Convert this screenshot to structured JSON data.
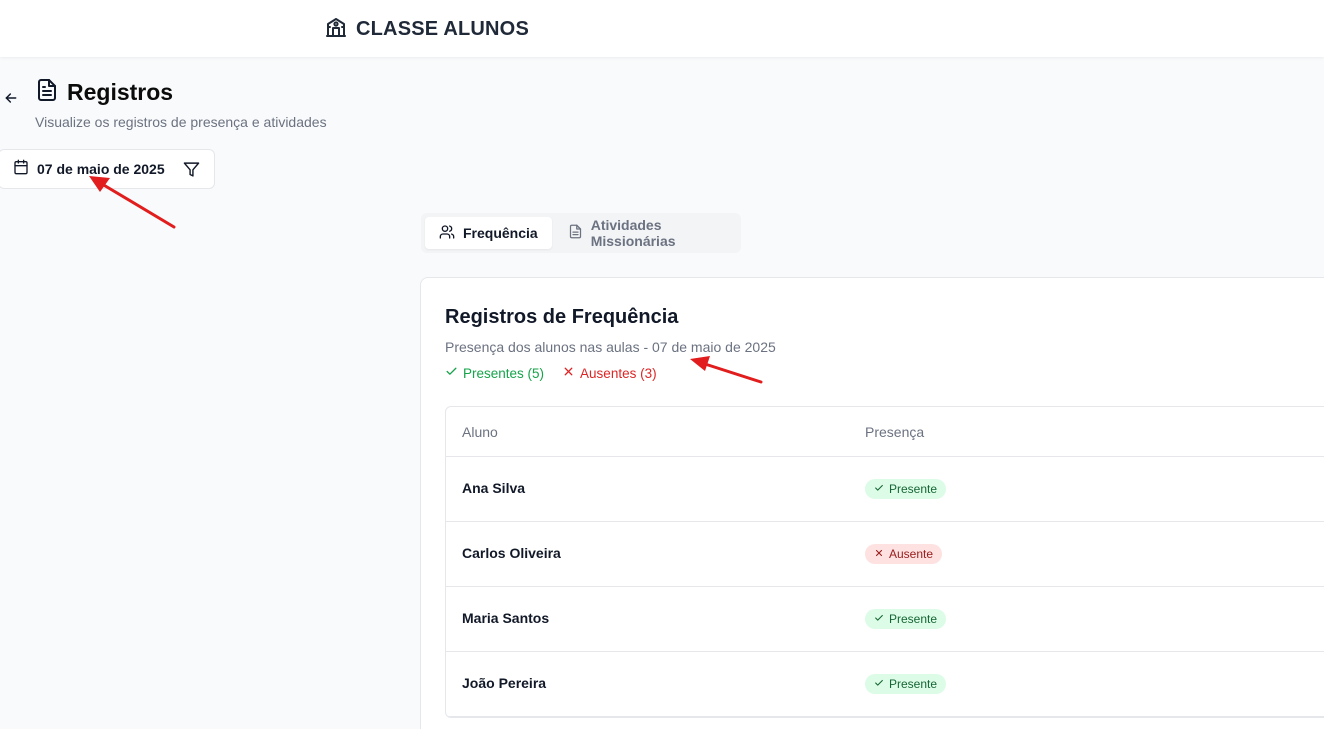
{
  "app": {
    "title": "CLASSE ALUNOS",
    "brand_icon": "school-icon"
  },
  "header": {
    "title": "Registros",
    "subtitle": "Visualize os registros de presença e atividades",
    "title_icon": "file-text-icon"
  },
  "date_filter": {
    "label": "07 de maio de 2025"
  },
  "tabs": [
    {
      "label": "Frequência",
      "icon": "users-icon",
      "active": true
    },
    {
      "label": "Atividades Missionárias",
      "icon": "file-text-icon",
      "active": false
    }
  ],
  "attendance": {
    "title": "Registros de Frequência",
    "subtitle": "Presença dos alunos nas aulas - 07 de maio de 2025",
    "present_count": "Presentes (5)",
    "absent_count": "Ausentes (3)",
    "columns": {
      "student": "Aluno",
      "presence": "Presença"
    },
    "rows": [
      {
        "name": "Ana Silva",
        "status": "Presente"
      },
      {
        "name": "Carlos Oliveira",
        "status": "Ausente"
      },
      {
        "name": "Maria Santos",
        "status": "Presente"
      },
      {
        "name": "João Pereira",
        "status": "Presente"
      }
    ]
  },
  "colors": {
    "present": "#16a34a",
    "absent": "#dc2626",
    "present_badge_bg": "#dcfce7",
    "absent_badge_bg": "#fee2e2",
    "annotation_arrow": "#e11d1d"
  }
}
